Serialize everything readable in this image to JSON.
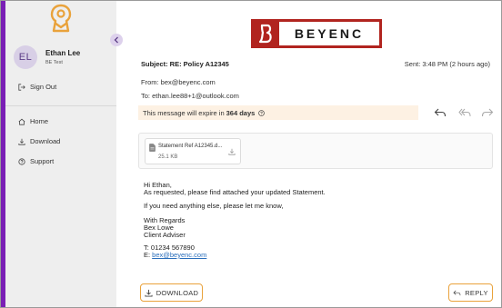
{
  "sidebar": {
    "user": {
      "initials": "EL",
      "name": "Ethan Lee",
      "subtitle": "BE Test"
    },
    "sign_out": "Sign Out",
    "nav": [
      {
        "label": "Home",
        "icon": "home-icon"
      },
      {
        "label": "Download",
        "icon": "download-icon"
      },
      {
        "label": "Support",
        "icon": "support-icon"
      }
    ],
    "accent_color": "#7a1fb5"
  },
  "brand": {
    "name": "BEYENC",
    "color": "#b1241f"
  },
  "message": {
    "subject": "Subject: RE: Policy A12345",
    "sent": "Sent: 3:48 PM (2 hours ago)",
    "from": "From: bex@beyenc.com",
    "to": "To: ethan.lee88+1@outlook.com",
    "expiry_prefix": "This message will expire in",
    "expiry_value": "364 days",
    "attachment": {
      "name": "Statement Ref A12345.d...",
      "size": "25.1 KB"
    },
    "body": {
      "greeting": "Hi Ethan,",
      "line1": "As requested, please find attached your updated Statement.",
      "line2": "If you need anything else, please let me know,",
      "sig1": "With Regards",
      "sig2": "Bex Lowe",
      "sig3": "Client Adviser",
      "phone": "T: 01234 567890",
      "email_prefix": "E: ",
      "email": "bex@beyenc.com"
    }
  },
  "buttons": {
    "download": "DOWNLOAD",
    "reply": "REPLY"
  },
  "colors": {
    "button_border": "#e9a23b",
    "expiry_bg": "#fdf1e3",
    "link": "#2a6ebb"
  }
}
